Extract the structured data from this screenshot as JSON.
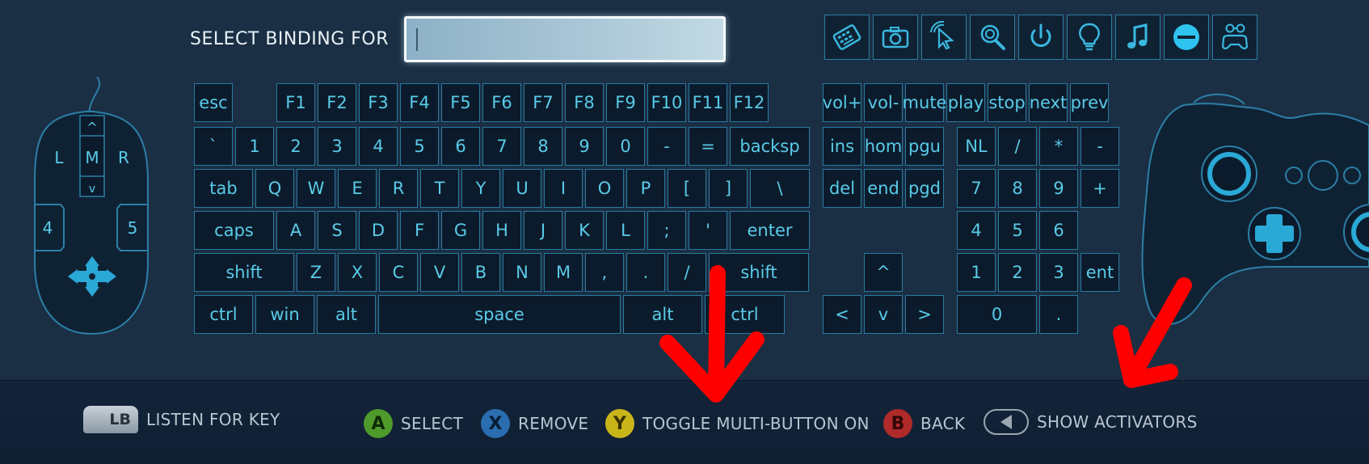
{
  "header": {
    "title": "SELECT BINDING FOR",
    "binding_value": ""
  },
  "category_icons": [
    {
      "name": "keyboard-icon",
      "glyph": "keyboard"
    },
    {
      "name": "camera-icon",
      "glyph": "camera"
    },
    {
      "name": "mouse-cursor-icon",
      "glyph": "cursor"
    },
    {
      "name": "magnifier-icon",
      "glyph": "magnifier"
    },
    {
      "name": "power-icon",
      "glyph": "power"
    },
    {
      "name": "lightbulb-icon",
      "glyph": "bulb"
    },
    {
      "name": "music-note-icon",
      "glyph": "music"
    },
    {
      "name": "remove-circle-icon",
      "glyph": "minus"
    },
    {
      "name": "gamepad-icon",
      "glyph": "gamepad"
    }
  ],
  "mouse": {
    "left": "L",
    "middle": "M",
    "right": "R",
    "scroll_up": "^",
    "scroll_down": "v",
    "button4": "4",
    "button5": "5"
  },
  "keys": {
    "function_row": [
      "esc",
      "F1",
      "F2",
      "F3",
      "F4",
      "F5",
      "F6",
      "F7",
      "F8",
      "F9",
      "F10",
      "F11",
      "F12"
    ],
    "number_row": [
      "`",
      "1",
      "2",
      "3",
      "4",
      "5",
      "6",
      "7",
      "8",
      "9",
      "0",
      "-",
      "=",
      "backsp"
    ],
    "top_row": [
      "tab",
      "Q",
      "W",
      "E",
      "R",
      "T",
      "Y",
      "U",
      "I",
      "O",
      "P",
      "[",
      "]",
      "\\"
    ],
    "home_row": [
      "caps",
      "A",
      "S",
      "D",
      "F",
      "G",
      "H",
      "J",
      "K",
      "L",
      ";",
      "'",
      "enter"
    ],
    "bottom_row": [
      "shift",
      "Z",
      "X",
      "C",
      "V",
      "B",
      "N",
      "M",
      ",",
      ".",
      "/",
      "shift"
    ],
    "space_row": [
      "ctrl",
      "win",
      "alt",
      "space",
      "alt",
      "ctrl"
    ],
    "media": [
      "vol+",
      "vol-",
      "mute",
      "play",
      "stop",
      "next",
      "prev"
    ],
    "nav_top": [
      "ins",
      "hom",
      "pgu"
    ],
    "nav_bottom": [
      "del",
      "end",
      "pgd"
    ],
    "arrows": [
      "^",
      "<",
      "v",
      ">"
    ],
    "numpad": [
      "NL",
      "/",
      "*",
      "-",
      "7",
      "8",
      "9",
      "+",
      "4",
      "5",
      "6",
      "1",
      "2",
      "3",
      "ent",
      "0",
      "."
    ]
  },
  "bottom_bar": {
    "listen": {
      "button": "LB",
      "label": "LISTEN FOR KEY"
    },
    "select": {
      "button": "A",
      "label": "SELECT",
      "color": "#4e9a2a"
    },
    "remove": {
      "button": "X",
      "label": "REMOVE",
      "color": "#2a6db0"
    },
    "toggle": {
      "button": "Y",
      "label": "TOGGLE MULTI-BUTTON ON",
      "color": "#c9b51a"
    },
    "back": {
      "button": "B",
      "label": "BACK",
      "color": "#b02a2a"
    },
    "activators": {
      "label": "SHOW ACTIVATORS"
    }
  },
  "colors": {
    "background": "#1a2f44",
    "key_text": "#59cbe8",
    "key_border": "#2a7aa0",
    "annotation_arrow": "#ff0000"
  }
}
